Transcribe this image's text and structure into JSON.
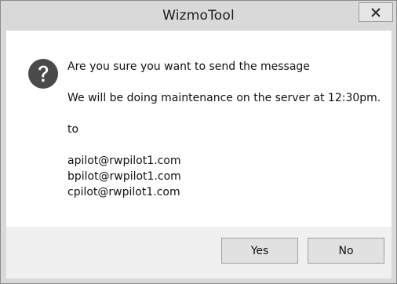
{
  "window": {
    "title": "WizmoTool",
    "close_icon": "close-icon"
  },
  "dialog": {
    "icon": "question-icon",
    "line1": "Are you sure you want to send the message",
    "line2": "We will be doing maintenance on the server at 12:30pm.",
    "line3": "to",
    "recipients": [
      "apilot@rwpilot1.com",
      "bpilot@rwpilot1.com",
      "cpilot@rwpilot1.com"
    ]
  },
  "buttons": {
    "yes": "Yes",
    "no": "No"
  },
  "colors": {
    "frame": "#d9d9d9",
    "content_bg": "#ffffff",
    "footer_bg": "#f0f0f0",
    "icon_bg": "#4a4a4a"
  }
}
